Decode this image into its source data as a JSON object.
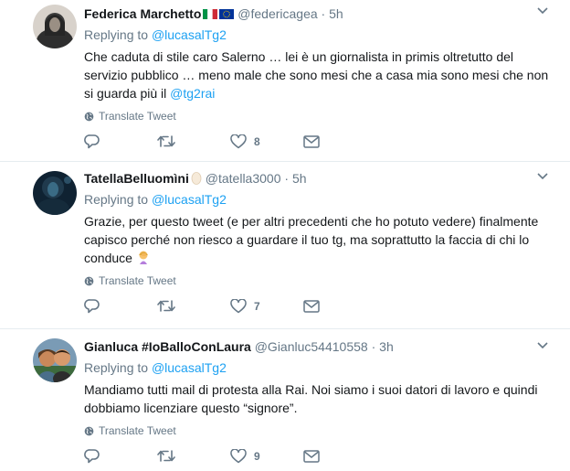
{
  "tweets": [
    {
      "name": "Federica Marchetto",
      "handle": "@federicagea",
      "sep": "·",
      "time": "5h",
      "replying_label": "Replying to",
      "replying_to": "@lucasalTg2",
      "text": "Che caduta di stile caro Salerno … lei è un giornalista in primis oltretutto del servizio pubblico … meno male che sono mesi che a casa mia sono mesi che non si guarda più il",
      "mention": "@tg2rai",
      "translate": "Translate Tweet",
      "likes": "8",
      "avatar_colors": [
        "#3b3b3b",
        "#9a8f84"
      ]
    },
    {
      "name": "TatellaBelluomìni",
      "handle": "@tatella3000",
      "sep": "·",
      "time": "5h",
      "replying_label": "Replying to",
      "replying_to": "@lucasalTg2",
      "text": "Grazie, per questo tweet (e per altri precedenti che ho potuto vedere) finalmente capisco perché non riesco a guardare il tuo tg, ma soprattutto la faccia di chi lo conduce",
      "translate": "Translate Tweet",
      "likes": "7",
      "avatar_colors": [
        "#0f2232",
        "#3a6b85"
      ]
    },
    {
      "name": "Gianluca #IoBalloConLaura",
      "handle": "@Gianluc54410558",
      "sep": "·",
      "time": "3h",
      "replying_label": "Replying to",
      "replying_to": "@lucasalTg2",
      "text": "Mandiamo tutti mail di protesta alla Rai. Noi siamo i suoi datori di lavoro e quindi dobbiamo licenziare questo “signore”.",
      "translate": "Translate Tweet",
      "likes": "9",
      "avatar_colors": [
        "#c9885a",
        "#3d6a3d"
      ]
    }
  ],
  "colors": {
    "accent": "#1da1f2",
    "muted": "#657786",
    "text": "#14171a",
    "border": "#e6ecf0"
  }
}
